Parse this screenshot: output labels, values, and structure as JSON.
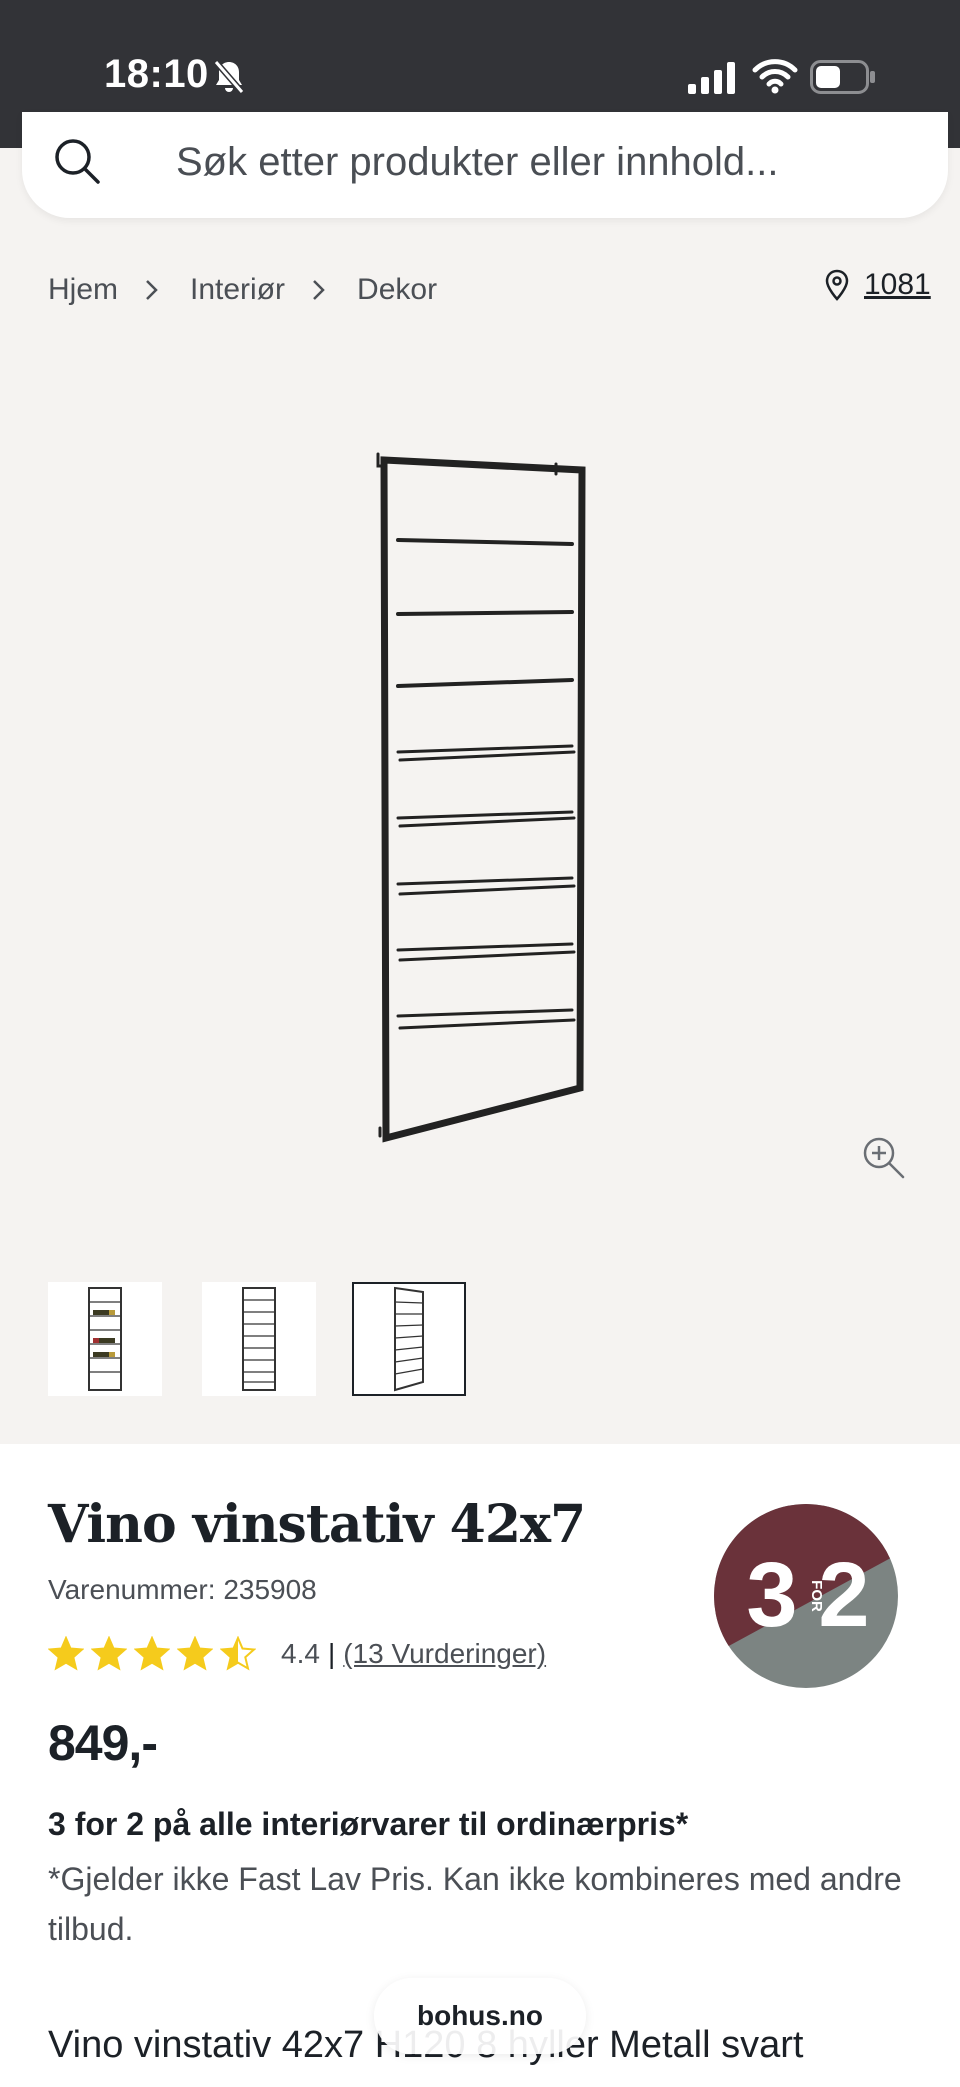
{
  "status_bar": {
    "time": "18:10"
  },
  "search": {
    "placeholder": "Søk etter produkter eller innhold..."
  },
  "breadcrumb": {
    "items": [
      "Hjem",
      "Interiør",
      "Dekor"
    ]
  },
  "store": {
    "label": "1081"
  },
  "product": {
    "title": "Vino vinstativ 42x7",
    "sku": "Varenummer: 235908",
    "rating_value": "4.4",
    "rating_stars": 4.5,
    "rating_separator": "|",
    "reviews_label": "(13 Vurderinger)",
    "price": "849,-",
    "promo_title": "3 for 2 på alle interiørvarer til ordinærpris*",
    "promo_description": "*Gjelder ikke Fast Lav Pris. Kan ikke kombineres med andre tilbud.",
    "description": "Vino vinstativ 42x7 H120 8 hyller Metall svart"
  },
  "badge": {
    "left": "3",
    "middle": "FOR",
    "right": "2",
    "colors": {
      "top": "#6a323a",
      "bottom": "#7c8482"
    }
  },
  "colors": {
    "status_bar": "#323337",
    "page_background": "#f5f3f1",
    "star": "#f5cb1c",
    "text": "#1c2127"
  },
  "browser": {
    "url": "bohus.no"
  }
}
